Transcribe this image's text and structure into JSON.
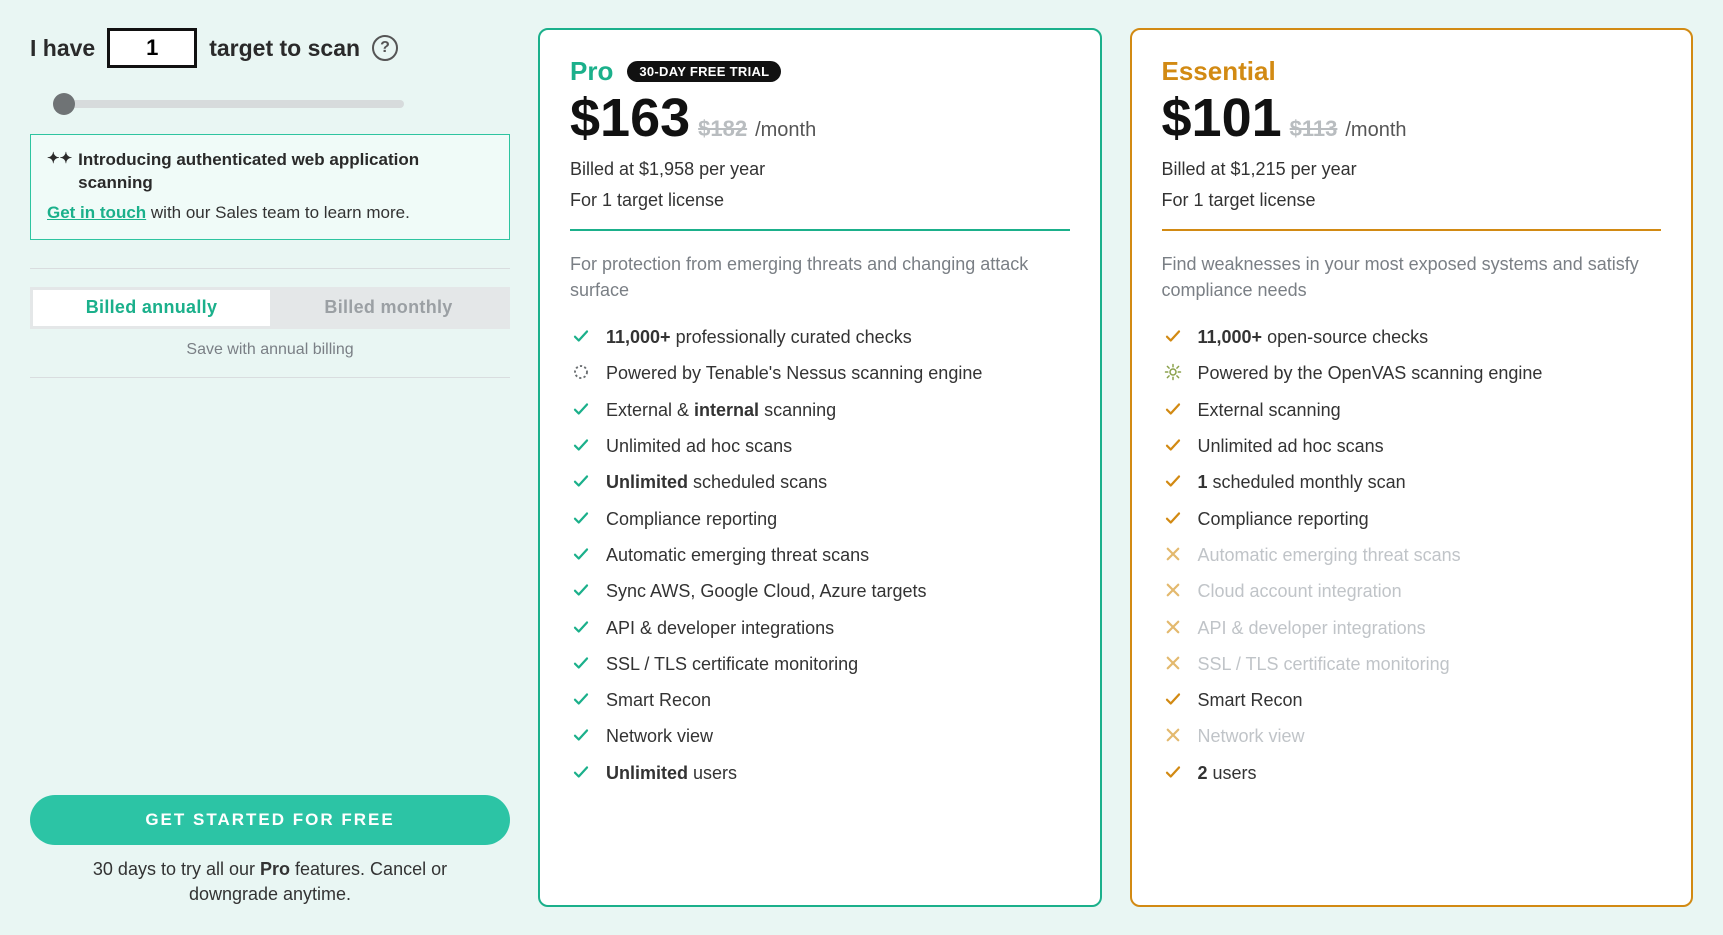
{
  "left": {
    "prefix": "I have",
    "target_value": "1",
    "suffix": "target to scan",
    "banner": {
      "title": "Introducing authenticated web application scanning",
      "link": "Get in touch",
      "rest": " with our Sales team to learn more."
    },
    "billing": {
      "annual": "Billed annually",
      "monthly": "Billed monthly",
      "note": "Save with annual billing"
    },
    "cta": "GET STARTED FOR FREE",
    "cta_note_pre": "30 days to try all our ",
    "cta_note_bold": "Pro",
    "cta_note_post": " features. Cancel or downgrade anytime."
  },
  "plans": {
    "pro": {
      "name": "Pro",
      "badge": "30-DAY FREE TRIAL",
      "price": "$163",
      "strike": "$182",
      "period": "/month",
      "billed": "Billed at $1,958 per year",
      "license": "For 1 target license",
      "tagline": "For protection from emerging threats and changing attack surface"
    },
    "essential": {
      "name": "Essential",
      "price": "$101",
      "strike": "$113",
      "period": "/month",
      "billed": "Billed at $1,215 per year",
      "license": "For 1 target license",
      "tagline": "Find weaknesses in your most exposed systems and satisfy compliance needs"
    }
  },
  "features": {
    "pro": [
      {
        "icon": "check",
        "html": "<b>11,000+</b> professionally curated checks"
      },
      {
        "icon": "ring",
        "html": "Powered by Tenable's Nessus scanning engine"
      },
      {
        "icon": "check",
        "html": "External & <b>internal</b> scanning"
      },
      {
        "icon": "check",
        "html": "Unlimited ad hoc scans"
      },
      {
        "icon": "check",
        "html": "<b>Unlimited</b> scheduled scans"
      },
      {
        "icon": "check",
        "html": "Compliance reporting"
      },
      {
        "icon": "check",
        "html": "Automatic emerging threat scans"
      },
      {
        "icon": "check",
        "html": "Sync AWS, Google Cloud, Azure targets"
      },
      {
        "icon": "check",
        "html": "API & developer integrations"
      },
      {
        "icon": "check",
        "html": "SSL / TLS certificate monitoring"
      },
      {
        "icon": "check",
        "html": "Smart Recon"
      },
      {
        "icon": "check",
        "html": "Network view"
      },
      {
        "icon": "check",
        "html": "<b>Unlimited</b> users"
      }
    ],
    "essential": [
      {
        "icon": "check",
        "html": "<b>11,000+</b> open-source checks"
      },
      {
        "icon": "sun",
        "html": "Powered by the OpenVAS scanning engine"
      },
      {
        "icon": "check",
        "html": "External scanning"
      },
      {
        "icon": "check",
        "html": "Unlimited ad hoc scans"
      },
      {
        "icon": "check",
        "html": "<b>1</b> scheduled monthly scan"
      },
      {
        "icon": "check",
        "html": "Compliance reporting"
      },
      {
        "icon": "cross",
        "html": "Automatic emerging threat scans",
        "muted": true
      },
      {
        "icon": "cross",
        "html": "Cloud account integration",
        "muted": true
      },
      {
        "icon": "cross",
        "html": "API & developer integrations",
        "muted": true
      },
      {
        "icon": "cross",
        "html": "SSL / TLS certificate monitoring",
        "muted": true
      },
      {
        "icon": "check",
        "html": "Smart Recon"
      },
      {
        "icon": "cross",
        "html": "Network view",
        "muted": true
      },
      {
        "icon": "check",
        "html": "<b>2</b> users"
      }
    ]
  }
}
